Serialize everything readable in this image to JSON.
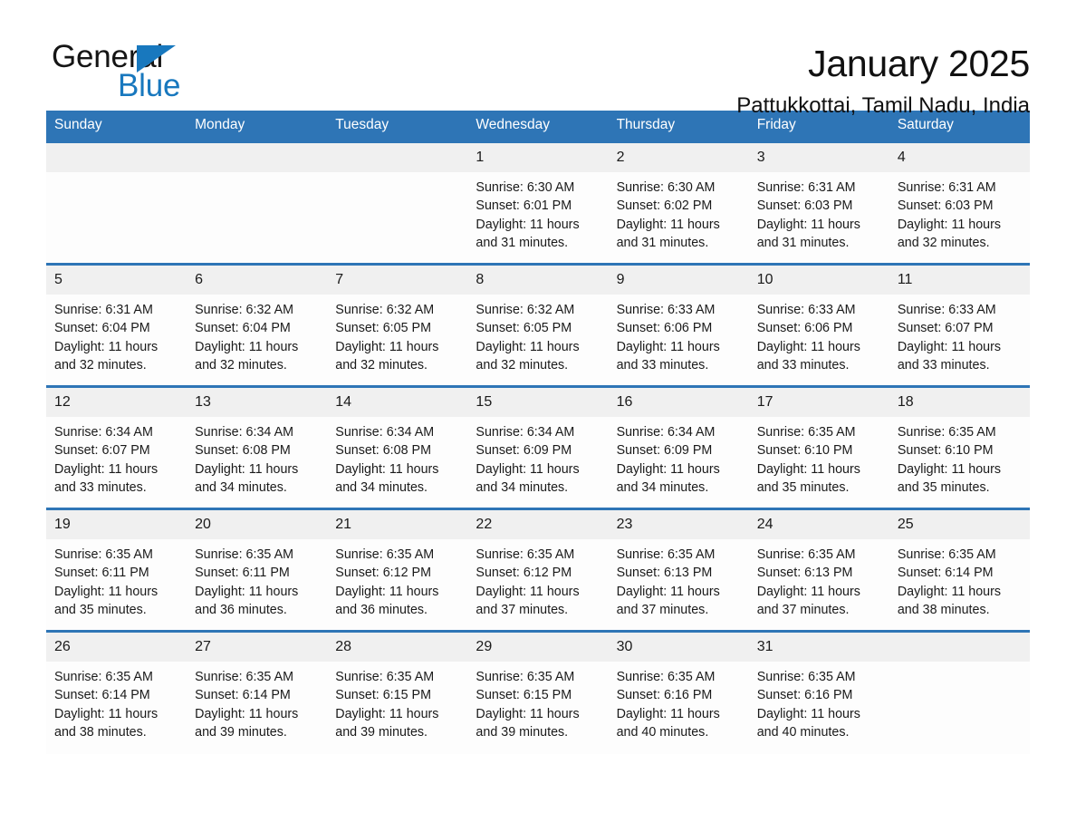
{
  "brand": {
    "name_top": "General",
    "name_bottom": "Blue",
    "triangle_color": "#1878be",
    "text_color": "#151515"
  },
  "header": {
    "title": "January 2025",
    "subtitle": "Pattukkottai, Tamil Nadu, India"
  },
  "theme": {
    "header_blue": "#2e75b6",
    "daynum_gray": "#f0f0f0",
    "cell_white": "#fdfdfd",
    "text_black": "#1a1a1a"
  },
  "calendar": {
    "weekday_headers": [
      "Sunday",
      "Monday",
      "Tuesday",
      "Wednesday",
      "Thursday",
      "Friday",
      "Saturday"
    ],
    "weeks": [
      [
        {
          "day": "",
          "sunrise": "",
          "sunset": "",
          "daylight_1": "",
          "daylight_2": ""
        },
        {
          "day": "",
          "sunrise": "",
          "sunset": "",
          "daylight_1": "",
          "daylight_2": ""
        },
        {
          "day": "",
          "sunrise": "",
          "sunset": "",
          "daylight_1": "",
          "daylight_2": ""
        },
        {
          "day": "1",
          "sunrise": "Sunrise: 6:30 AM",
          "sunset": "Sunset: 6:01 PM",
          "daylight_1": "Daylight: 11 hours",
          "daylight_2": "and 31 minutes."
        },
        {
          "day": "2",
          "sunrise": "Sunrise: 6:30 AM",
          "sunset": "Sunset: 6:02 PM",
          "daylight_1": "Daylight: 11 hours",
          "daylight_2": "and 31 minutes."
        },
        {
          "day": "3",
          "sunrise": "Sunrise: 6:31 AM",
          "sunset": "Sunset: 6:03 PM",
          "daylight_1": "Daylight: 11 hours",
          "daylight_2": "and 31 minutes."
        },
        {
          "day": "4",
          "sunrise": "Sunrise: 6:31 AM",
          "sunset": "Sunset: 6:03 PM",
          "daylight_1": "Daylight: 11 hours",
          "daylight_2": "and 32 minutes."
        }
      ],
      [
        {
          "day": "5",
          "sunrise": "Sunrise: 6:31 AM",
          "sunset": "Sunset: 6:04 PM",
          "daylight_1": "Daylight: 11 hours",
          "daylight_2": "and 32 minutes."
        },
        {
          "day": "6",
          "sunrise": "Sunrise: 6:32 AM",
          "sunset": "Sunset: 6:04 PM",
          "daylight_1": "Daylight: 11 hours",
          "daylight_2": "and 32 minutes."
        },
        {
          "day": "7",
          "sunrise": "Sunrise: 6:32 AM",
          "sunset": "Sunset: 6:05 PM",
          "daylight_1": "Daylight: 11 hours",
          "daylight_2": "and 32 minutes."
        },
        {
          "day": "8",
          "sunrise": "Sunrise: 6:32 AM",
          "sunset": "Sunset: 6:05 PM",
          "daylight_1": "Daylight: 11 hours",
          "daylight_2": "and 32 minutes."
        },
        {
          "day": "9",
          "sunrise": "Sunrise: 6:33 AM",
          "sunset": "Sunset: 6:06 PM",
          "daylight_1": "Daylight: 11 hours",
          "daylight_2": "and 33 minutes."
        },
        {
          "day": "10",
          "sunrise": "Sunrise: 6:33 AM",
          "sunset": "Sunset: 6:06 PM",
          "daylight_1": "Daylight: 11 hours",
          "daylight_2": "and 33 minutes."
        },
        {
          "day": "11",
          "sunrise": "Sunrise: 6:33 AM",
          "sunset": "Sunset: 6:07 PM",
          "daylight_1": "Daylight: 11 hours",
          "daylight_2": "and 33 minutes."
        }
      ],
      [
        {
          "day": "12",
          "sunrise": "Sunrise: 6:34 AM",
          "sunset": "Sunset: 6:07 PM",
          "daylight_1": "Daylight: 11 hours",
          "daylight_2": "and 33 minutes."
        },
        {
          "day": "13",
          "sunrise": "Sunrise: 6:34 AM",
          "sunset": "Sunset: 6:08 PM",
          "daylight_1": "Daylight: 11 hours",
          "daylight_2": "and 34 minutes."
        },
        {
          "day": "14",
          "sunrise": "Sunrise: 6:34 AM",
          "sunset": "Sunset: 6:08 PM",
          "daylight_1": "Daylight: 11 hours",
          "daylight_2": "and 34 minutes."
        },
        {
          "day": "15",
          "sunrise": "Sunrise: 6:34 AM",
          "sunset": "Sunset: 6:09 PM",
          "daylight_1": "Daylight: 11 hours",
          "daylight_2": "and 34 minutes."
        },
        {
          "day": "16",
          "sunrise": "Sunrise: 6:34 AM",
          "sunset": "Sunset: 6:09 PM",
          "daylight_1": "Daylight: 11 hours",
          "daylight_2": "and 34 minutes."
        },
        {
          "day": "17",
          "sunrise": "Sunrise: 6:35 AM",
          "sunset": "Sunset: 6:10 PM",
          "daylight_1": "Daylight: 11 hours",
          "daylight_2": "and 35 minutes."
        },
        {
          "day": "18",
          "sunrise": "Sunrise: 6:35 AM",
          "sunset": "Sunset: 6:10 PM",
          "daylight_1": "Daylight: 11 hours",
          "daylight_2": "and 35 minutes."
        }
      ],
      [
        {
          "day": "19",
          "sunrise": "Sunrise: 6:35 AM",
          "sunset": "Sunset: 6:11 PM",
          "daylight_1": "Daylight: 11 hours",
          "daylight_2": "and 35 minutes."
        },
        {
          "day": "20",
          "sunrise": "Sunrise: 6:35 AM",
          "sunset": "Sunset: 6:11 PM",
          "daylight_1": "Daylight: 11 hours",
          "daylight_2": "and 36 minutes."
        },
        {
          "day": "21",
          "sunrise": "Sunrise: 6:35 AM",
          "sunset": "Sunset: 6:12 PM",
          "daylight_1": "Daylight: 11 hours",
          "daylight_2": "and 36 minutes."
        },
        {
          "day": "22",
          "sunrise": "Sunrise: 6:35 AM",
          "sunset": "Sunset: 6:12 PM",
          "daylight_1": "Daylight: 11 hours",
          "daylight_2": "and 37 minutes."
        },
        {
          "day": "23",
          "sunrise": "Sunrise: 6:35 AM",
          "sunset": "Sunset: 6:13 PM",
          "daylight_1": "Daylight: 11 hours",
          "daylight_2": "and 37 minutes."
        },
        {
          "day": "24",
          "sunrise": "Sunrise: 6:35 AM",
          "sunset": "Sunset: 6:13 PM",
          "daylight_1": "Daylight: 11 hours",
          "daylight_2": "and 37 minutes."
        },
        {
          "day": "25",
          "sunrise": "Sunrise: 6:35 AM",
          "sunset": "Sunset: 6:14 PM",
          "daylight_1": "Daylight: 11 hours",
          "daylight_2": "and 38 minutes."
        }
      ],
      [
        {
          "day": "26",
          "sunrise": "Sunrise: 6:35 AM",
          "sunset": "Sunset: 6:14 PM",
          "daylight_1": "Daylight: 11 hours",
          "daylight_2": "and 38 minutes."
        },
        {
          "day": "27",
          "sunrise": "Sunrise: 6:35 AM",
          "sunset": "Sunset: 6:14 PM",
          "daylight_1": "Daylight: 11 hours",
          "daylight_2": "and 39 minutes."
        },
        {
          "day": "28",
          "sunrise": "Sunrise: 6:35 AM",
          "sunset": "Sunset: 6:15 PM",
          "daylight_1": "Daylight: 11 hours",
          "daylight_2": "and 39 minutes."
        },
        {
          "day": "29",
          "sunrise": "Sunrise: 6:35 AM",
          "sunset": "Sunset: 6:15 PM",
          "daylight_1": "Daylight: 11 hours",
          "daylight_2": "and 39 minutes."
        },
        {
          "day": "30",
          "sunrise": "Sunrise: 6:35 AM",
          "sunset": "Sunset: 6:16 PM",
          "daylight_1": "Daylight: 11 hours",
          "daylight_2": "and 40 minutes."
        },
        {
          "day": "31",
          "sunrise": "Sunrise: 6:35 AM",
          "sunset": "Sunset: 6:16 PM",
          "daylight_1": "Daylight: 11 hours",
          "daylight_2": "and 40 minutes."
        },
        {
          "day": "",
          "sunrise": "",
          "sunset": "",
          "daylight_1": "",
          "daylight_2": ""
        }
      ]
    ]
  }
}
